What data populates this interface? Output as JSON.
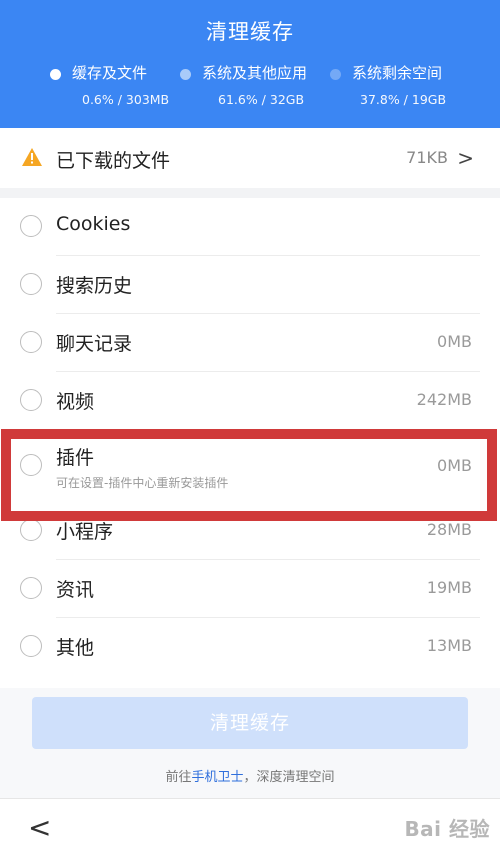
{
  "header": {
    "title": "清理缓存",
    "legend": [
      {
        "name": "缓存及文件",
        "value": "0.6% / 303MB",
        "color": "#ffffff"
      },
      {
        "name": "系统及其他应用",
        "value": "61.6% / 32GB",
        "color": "#a9cbf9"
      },
      {
        "name": "系统剩余空间",
        "value": "37.8% / 19GB",
        "color": "#74a9f6"
      }
    ]
  },
  "downloaded": {
    "label": "已下载的文件",
    "size": "71KB",
    "chevron": ">",
    "icon": "warning-icon"
  },
  "items": [
    {
      "label": "Cookies",
      "size": ""
    },
    {
      "label": "搜索历史",
      "size": ""
    },
    {
      "label": "聊天记录",
      "size": "0MB"
    },
    {
      "label": "视频",
      "size": "242MB"
    },
    {
      "label": "插件",
      "size": "0MB",
      "note": "可在设置-插件中心重新安装插件"
    },
    {
      "label": "小程序",
      "size": "28MB"
    },
    {
      "label": "资讯",
      "size": "19MB"
    },
    {
      "label": "其他",
      "size": "13MB"
    }
  ],
  "clean_button": "清理缓存",
  "hint": {
    "prefix": "前往",
    "link": "手机卫士",
    "suffix": "，深度清理空间"
  },
  "nav": {
    "back": "<"
  },
  "watermark": "Bai 经验"
}
